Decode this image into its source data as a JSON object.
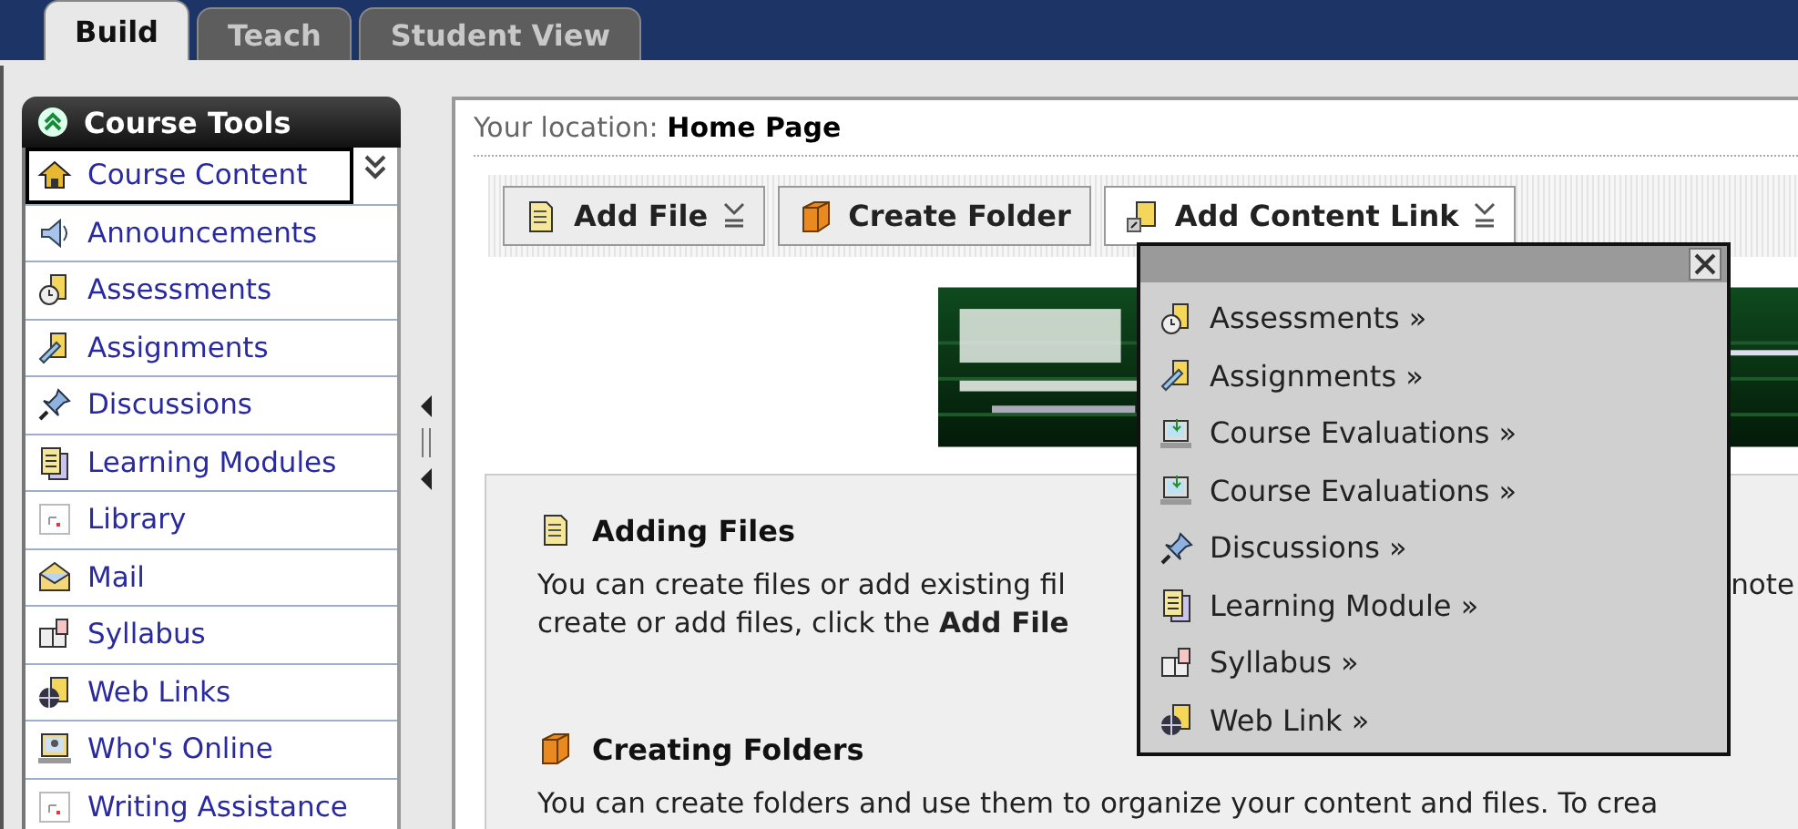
{
  "tabs": [
    {
      "label": "Build",
      "selected": true
    },
    {
      "label": "Teach",
      "selected": false
    },
    {
      "label": "Student View",
      "selected": false
    }
  ],
  "sidebar": {
    "title": "Course Tools",
    "items": [
      {
        "label": "Course Content",
        "selected": true
      },
      {
        "label": "Announcements",
        "selected": false
      },
      {
        "label": "Assessments",
        "selected": false
      },
      {
        "label": "Assignments",
        "selected": false
      },
      {
        "label": "Discussions",
        "selected": false
      },
      {
        "label": "Learning Modules",
        "selected": false
      },
      {
        "label": "Library",
        "selected": false
      },
      {
        "label": "Mail",
        "selected": false
      },
      {
        "label": "Syllabus",
        "selected": false
      },
      {
        "label": "Web Links",
        "selected": false
      },
      {
        "label": "Who's Online",
        "selected": false
      },
      {
        "label": "Writing Assistance",
        "selected": false
      }
    ]
  },
  "location": {
    "label": "Your location:",
    "value": "Home Page"
  },
  "toolbar": [
    {
      "label": "Add File",
      "has_menu": true,
      "open": false
    },
    {
      "label": "Create Folder",
      "has_menu": false,
      "open": false
    },
    {
      "label": "Add Content Link",
      "has_menu": true,
      "open": true
    }
  ],
  "sections": [
    {
      "title": "Adding Files",
      "lines": [
        {
          "text": "You can create files or add existing fil",
          "aside": "note"
        },
        {
          "text": "create or add files, click the **Add File**"
        }
      ]
    },
    {
      "title": "Creating Folders",
      "lines": [
        {
          "text": "You can create folders and use them to organize your content and files. To crea"
        }
      ]
    }
  ],
  "menu": {
    "items": [
      {
        "label": "Assessments »"
      },
      {
        "label": "Assignments »"
      },
      {
        "label": "Course Evaluations »"
      },
      {
        "label": "Course Evaluations »"
      },
      {
        "label": "Discussions »"
      },
      {
        "label": "Learning Module »"
      },
      {
        "label": "Syllabus »"
      },
      {
        "label": "Web Link »"
      }
    ]
  }
}
